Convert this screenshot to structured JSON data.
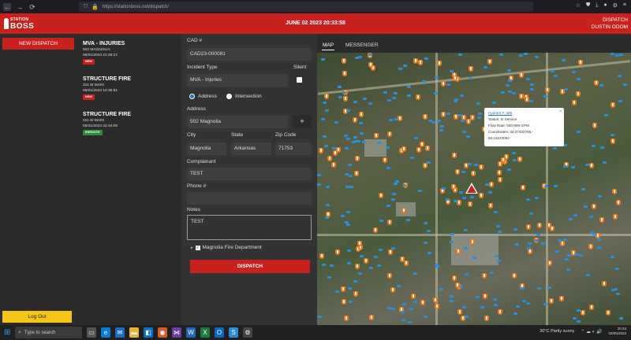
{
  "browser": {
    "url": "https://stationboss.net/dispatch/",
    "back_icon": "back-arrow-icon",
    "forward_icon": "forward-arrow-icon",
    "reload_icon": "reload-icon"
  },
  "header": {
    "logo_top": "STATION",
    "logo_bottom": "BOSS",
    "datetime": "JUNE 02 2023 20:33:58",
    "role": "DISPATCH",
    "user": "DUSTIN ODOM",
    "color": "#c9211e"
  },
  "sidebar": {
    "new_dispatch_label": "NEW DISPATCH",
    "logout_label": "Log Out"
  },
  "incidents": [
    {
      "title": "MVA - INJURIES",
      "address": "502 MAGNOLIA",
      "timestamp": "06/01/2023 21:25:17",
      "badge": "NEW"
    },
    {
      "title": "STRUCTURE FIRE",
      "address": "311 W MAIN",
      "timestamp": "06/01/2023 10:36:51",
      "badge": "NEW"
    },
    {
      "title": "STRUCTURE FIRE",
      "address": "311 W MAIN",
      "timestamp": "05/31/2023 22:45:08",
      "badge": "ENROUTE"
    }
  ],
  "form": {
    "cad_label": "CAD #",
    "cad_value": "CAD23-000081",
    "incident_type_label": "Incident Type",
    "incident_type_value": "MVA - Injuries",
    "silent_label": "Silent",
    "address_radio_label": "Address",
    "intersection_radio_label": "Intersection",
    "address_label": "Address",
    "address_value": "502  Magnolia",
    "city_label": "City",
    "city_value": "Magnolia",
    "state_label": "State",
    "state_value": "Arkansas",
    "zip_label": "Zip Code",
    "zip_value": "71753",
    "complainant_label": "Complainant",
    "complainant_value": "TEST",
    "phone_label": "Phone #",
    "phone_value": "",
    "notes_label": "Notes",
    "notes_value": "TEST",
    "department_label": "Magnolia Fire Department",
    "dispatch_label": "DISPATCH"
  },
  "map": {
    "tab_map": "MAP",
    "tab_messenger": "MESSENGER",
    "popup": {
      "title": "Hydrant #: 285",
      "status": "Status: In Service",
      "flow": "Flow Rate: 500-999 GPM",
      "coords": "Coordinates: 33.27432766,-",
      "coords2": "93.23223092"
    }
  },
  "taskbar": {
    "search_placeholder": "Type to search",
    "weather": "30°C  Partly sunny",
    "time": "20:33",
    "date": "02/06/2023"
  }
}
